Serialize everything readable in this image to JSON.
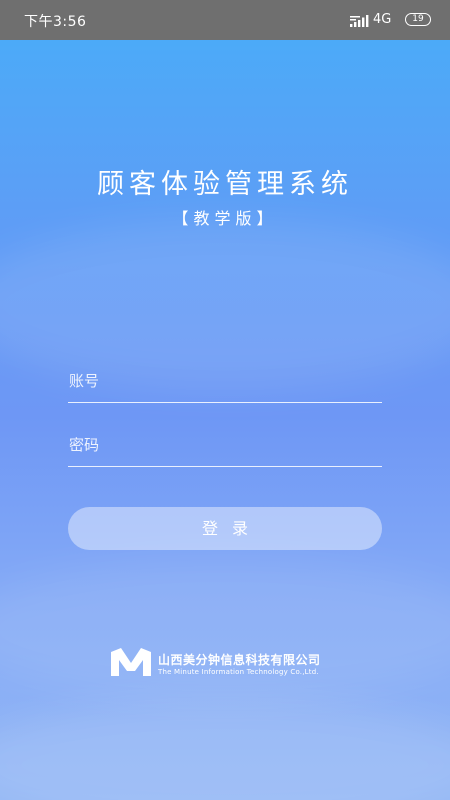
{
  "status_bar": {
    "time": "下午3:56",
    "network": "4G",
    "battery": "19"
  },
  "app": {
    "title": "顾客体验管理系统",
    "subtitle": "【教学版】"
  },
  "form": {
    "account_placeholder": "账号",
    "password_placeholder": "密码",
    "login_label": "登录"
  },
  "company": {
    "name": "山西美分钟信息科技有限公司",
    "english_name": "The Minute Information Technology Co.,Ltd.",
    "logo_icon": "m-logo-icon"
  },
  "colors": {
    "background_top": "#48adf8",
    "background_bottom": "#93b7f5",
    "status_bar": "#6f6f6f",
    "text": "#ffffff"
  }
}
